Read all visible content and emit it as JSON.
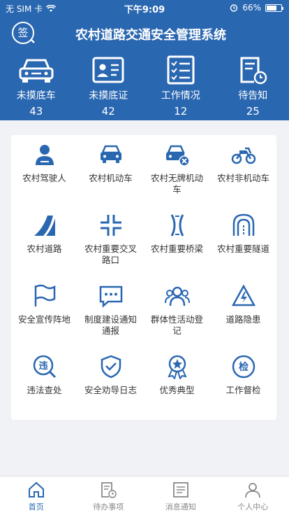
{
  "status_bar": {
    "carrier": "无 SIM 卡",
    "time": "下午9:09",
    "battery": "66%"
  },
  "header": {
    "logo_text": "签",
    "title": "农村道路交通安全管理系统"
  },
  "stats": [
    {
      "label": "未摸底车",
      "value": "43",
      "icon": "car-icon"
    },
    {
      "label": "未摸底证",
      "value": "42",
      "icon": "id-card-icon"
    },
    {
      "label": "工作情况",
      "value": "12",
      "icon": "checklist-icon"
    },
    {
      "label": "待告知",
      "value": "25",
      "icon": "document-clock-icon"
    }
  ],
  "grid": [
    {
      "label": "农村驾驶人",
      "icon": "driver-icon"
    },
    {
      "label": "农村机动车",
      "icon": "car-icon"
    },
    {
      "label": "农村无牌机动车",
      "icon": "car-no-plate-icon"
    },
    {
      "label": "农村非机动车",
      "icon": "motorcycle-icon"
    },
    {
      "label": "农村道路",
      "icon": "road-icon"
    },
    {
      "label": "农村重要交叉路口",
      "icon": "intersection-icon"
    },
    {
      "label": "农村重要桥梁",
      "icon": "bridge-icon"
    },
    {
      "label": "农村重要隧道",
      "icon": "tunnel-icon"
    },
    {
      "label": "安全宣传阵地",
      "icon": "flag-icon"
    },
    {
      "label": "制度建设通知通报",
      "icon": "message-icon"
    },
    {
      "label": "群体性活动登记",
      "icon": "group-icon"
    },
    {
      "label": "道路隐患",
      "icon": "warning-icon"
    },
    {
      "label": "违法查处",
      "icon": "violation-search-icon",
      "glyph": "违"
    },
    {
      "label": "安全劝导日志",
      "icon": "shield-check-icon"
    },
    {
      "label": "优秀典型",
      "icon": "star-medal-icon"
    },
    {
      "label": "工作督检",
      "icon": "inspect-icon",
      "glyph": "检"
    }
  ],
  "tabs": [
    {
      "label": "首页",
      "icon": "home-icon",
      "active": true
    },
    {
      "label": "待办事项",
      "icon": "todo-icon",
      "active": false
    },
    {
      "label": "消息通知",
      "icon": "message-list-icon",
      "active": false
    },
    {
      "label": "个人中心",
      "icon": "person-icon",
      "active": false
    }
  ],
  "colors": {
    "primary": "#2a67b1",
    "icon_blue": "#2a67b1",
    "inactive": "#888888"
  }
}
